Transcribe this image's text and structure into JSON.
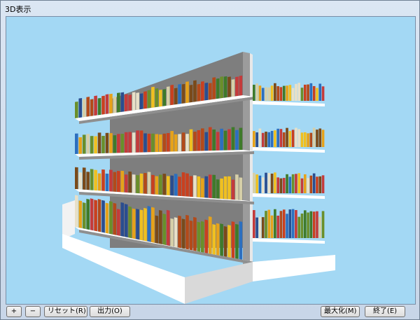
{
  "window": {
    "title": "3D表示"
  },
  "toolbar": {
    "zoom_in_label": "+",
    "zoom_out_label": "−",
    "reset_label": "リセット(R)",
    "output_label": "出力(O)",
    "maximize_label": "最大化(M)",
    "exit_label": "終了(E)"
  },
  "scene": {
    "background_color": "#a3d8f4",
    "shelf_color": "#ffffff",
    "shelf_shadow_color": "#8f8f8f",
    "bottle_palette": [
      "#c9401f",
      "#e6a21a",
      "#6a8f2a",
      "#d6cfa8",
      "#2a4d8f",
      "#b34a1a",
      "#e8e0c8",
      "#3f7a2a",
      "#c43b3b",
      "#2c6fbf",
      "#f0c020",
      "#7a4a1a"
    ]
  }
}
